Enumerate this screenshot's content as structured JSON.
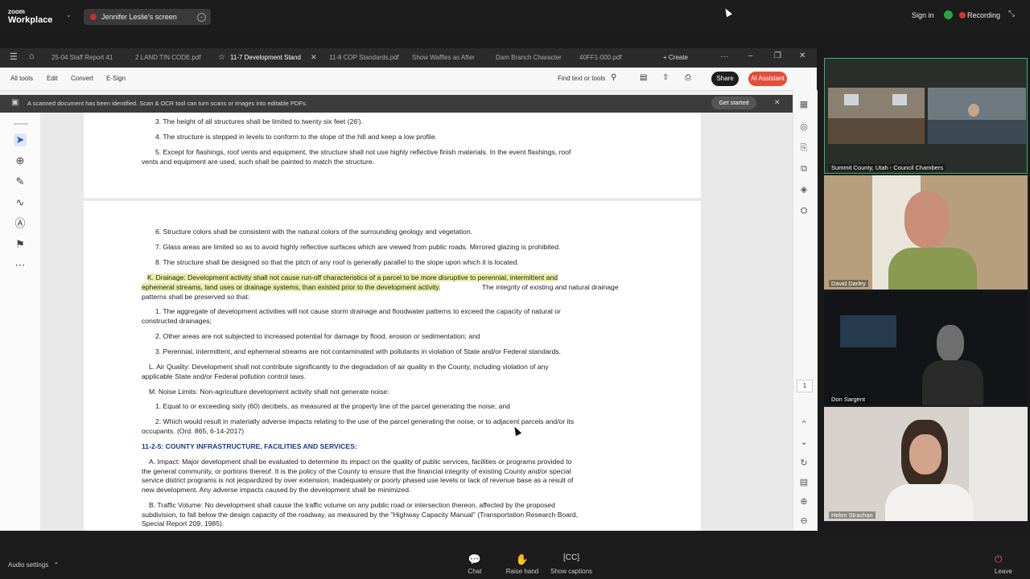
{
  "zoom": {
    "logo_line1": "zoom",
    "logo_line2": "Workplace",
    "share_label": "Jennifer Leslie's screen",
    "signin": "Sign in",
    "recording": "Recording"
  },
  "acrobat": {
    "tabs": [
      "25-04 Staff Report 41",
      "2 LAND TIN CODE.pdf",
      "11-7 Development Stand",
      "11-8 COP Standards.pdf",
      "Show Waffles as After",
      "Dam Branch Character",
      "40FF1-000.pdf"
    ],
    "create_label": "Create",
    "menu": [
      "All tools",
      "Edit",
      "Convert",
      "E-Sign"
    ],
    "find_label": "Find text or tools",
    "share_label": "Share",
    "ai_label": "AI Assistant",
    "notice": "A scanned document has been identified. Scan & OCR tool can turn scans or images into editable PDFs.",
    "get_started": "Get started",
    "page_number": "1"
  },
  "document": {
    "lines": [
      "3.  The height of all structures shall be limited to twenty six feet (26').",
      "4.  The structure is stepped in levels to conform to the slope of the hill and keep a low profile.",
      "5.  Except for flashings, roof vents and equipment, the structure shall not use highly reflective finish materials. In the event flashings, roof",
      "vents and equipment are used, such shall be painted to match the structure.",
      "6.  Structure colors shall be consistent with the natural colors of the surrounding geology and vegetation.",
      "7.  Glass areas are limited so as to avoid highly reflective surfaces which are viewed from public roads. Mirrored glazing is prohibited.",
      "8.  The structure shall be designed so that the pitch of any roof is generally parallel to the slope upon which it is located.",
      "K.  Drainage: Development activity shall not cause run-off characteristics of a parcel to be more disruptive to perennial, intermittent and",
      "ephemeral streams, land uses or drainage systems, than existed prior to the development activity.",
      " The integrity of existing and natural drainage",
      "patterns shall be preserved so that:",
      "1.  The aggregate of development activities will not cause storm drainage and floodwater patterns to exceed the capacity of natural or",
      "constructed drainages;",
      "2.  Other areas are not subjected to increased potential for damage by flood, erosion or sedimentation; and",
      "3.  Perennial, intermittent, and ephemeral streams are not contaminated with pollutants in violation of State and/or Federal standards.",
      "L.  Air Quality: Development shall not contribute significantly to the degradation of air quality in the County, including violation of any",
      "applicable State and/or Federal pollution control laws.",
      "M.  Noise Limits: Non-agriculture development activity shall not generate noise:",
      "1.  Equal to or exceeding sixty (60) decibels, as measured at the property line of the parcel generating the noise; and",
      "2.  Which would result in materially adverse impacts relating to the use of the parcel generating the noise, or to adjacent parcels and/or its",
      "occupants. (Ord. 865, 6-14-2017)",
      "11-2-5: COUNTY INFRASTRUCTURE, FACILITIES AND SERVICES:",
      "A.  Impact: Major development shall be evaluated to determine its impact on the quality of public services, facilities or programs provided to",
      "the general community, or portions thereof. It is the policy of the County to ensure that the financial integrity of existing County and/or special",
      "service district programs is not jeopardized by over extension, inadequately or poorly phased use levels or lack of revenue base as a result of",
      "new development. Any adverse impacts caused by the development shall be minimized.",
      "B.  Traffic Volume: No development shall cause the traffic volume on any public road or intersection thereon, affected by the proposed",
      "subdivision, to fall below the design capacity of the roadway, as measured by the \"Highway Capacity Manual\" (Transportation Research Board,",
      "Special Report 209, 1985)."
    ]
  },
  "participants": [
    {
      "name": "Summit County, Utah - Council Chambers"
    },
    {
      "name": "David Darley"
    },
    {
      "name": "Don Sargent"
    },
    {
      "name": "Helen Strachan"
    }
  ],
  "bottom": {
    "audio": "Audio settings",
    "chat": "Chat",
    "raise_hand": "Raise hand",
    "captions": "Show captions",
    "leave": "Leave"
  }
}
